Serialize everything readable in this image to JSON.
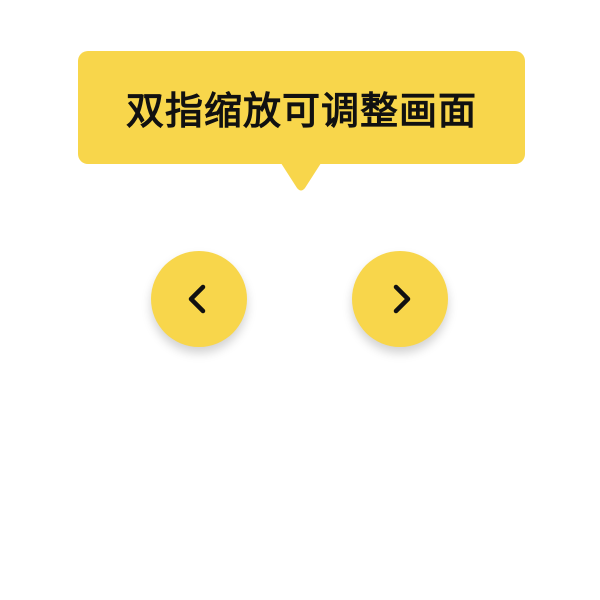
{
  "tooltip": {
    "text": "双指缩放可调整画面"
  },
  "controls": {
    "prev_icon": "chevron-left-icon",
    "next_icon": "chevron-right-icon"
  },
  "colors": {
    "accent": "#F8D64B",
    "text": "#111111",
    "background": "#FFFFFF"
  }
}
